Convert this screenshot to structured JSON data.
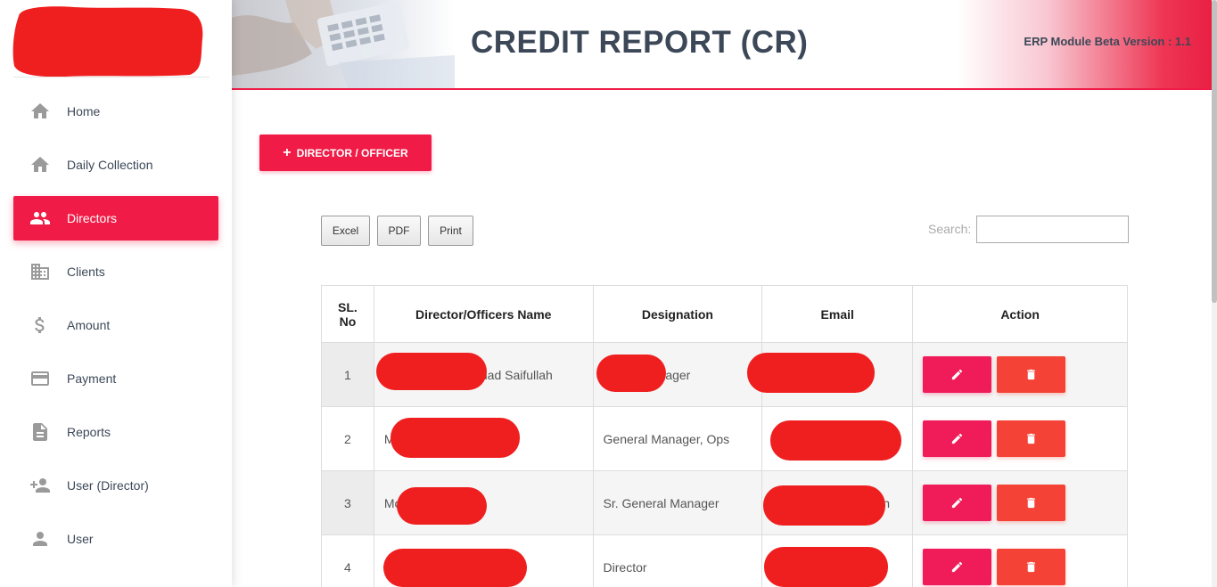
{
  "header": {
    "title": "CREDIT REPORT (CR)",
    "version": "ERP Module Beta Version : 1.1"
  },
  "sidebar": {
    "items": [
      {
        "label": "Home",
        "icon": "home-icon",
        "active": false
      },
      {
        "label": "Daily Collection",
        "icon": "home-icon",
        "active": false
      },
      {
        "label": "Directors",
        "icon": "people-icon",
        "active": true
      },
      {
        "label": "Clients",
        "icon": "building-icon",
        "active": false
      },
      {
        "label": "Amount",
        "icon": "dollar-icon",
        "active": false
      },
      {
        "label": "Payment",
        "icon": "credit-card-icon",
        "active": false
      },
      {
        "label": "Reports",
        "icon": "document-icon",
        "active": false
      },
      {
        "label": "User (Director)",
        "icon": "person-add-icon",
        "active": false
      },
      {
        "label": "User",
        "icon": "person-icon",
        "active": false
      }
    ]
  },
  "toolbar": {
    "add_label": "DIRECTOR / OFFICER",
    "excel_label": "Excel",
    "pdf_label": "PDF",
    "print_label": "Print",
    "search_label": "Search:",
    "search_value": ""
  },
  "table": {
    "headers": {
      "sl_line1": "SL.",
      "sl_line2": "No",
      "name": "Director/Officers Name",
      "designation": "Designation",
      "email": "Email",
      "action": "Action"
    },
    "rows": [
      {
        "sl": "1",
        "name": "had Saifullah",
        "designation": "nager",
        "email": ""
      },
      {
        "sl": "2",
        "name": "M",
        "designation": "General Manager, Ops",
        "email": ""
      },
      {
        "sl": "3",
        "name": "Mo",
        "designation": "Sr. General Manager",
        "email": "n"
      },
      {
        "sl": "4",
        "name": "",
        "designation": "Director",
        "email": ""
      }
    ]
  },
  "colors": {
    "accent": "#f01c47",
    "delete": "#f44336",
    "redaction": "#ef1f1f"
  }
}
